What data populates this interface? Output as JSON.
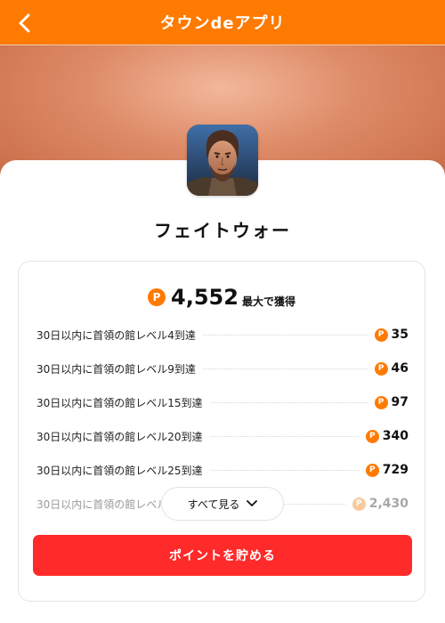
{
  "header": {
    "title": "タウンdeアプリ",
    "back_icon": "chevron-left-icon"
  },
  "app": {
    "name": "フェイトウォー",
    "icon": "warrior-portrait-icon"
  },
  "colors": {
    "brand": "#ff7a00",
    "cta": "#ff2a2a"
  },
  "points": {
    "coin_symbol": "P",
    "total": "4,552",
    "total_label": "最大で獲得",
    "items": [
      {
        "label": "30日以内に首領の館レベル4到達",
        "points": "35"
      },
      {
        "label": "30日以内に首領の館レベル9到達",
        "points": "46"
      },
      {
        "label": "30日以内に首領の館レベル15到達",
        "points": "97"
      },
      {
        "label": "30日以内に首領の館レベル20到達",
        "points": "340"
      },
      {
        "label": "30日以内に首領の館レベル25到達",
        "points": "729"
      },
      {
        "label": "30日以内に首領の館レベル",
        "points": "2,430"
      }
    ]
  },
  "see_all": {
    "label": "すべて見る",
    "icon": "chevron-down-icon"
  },
  "cta": {
    "label": "ポイントを貯める"
  }
}
